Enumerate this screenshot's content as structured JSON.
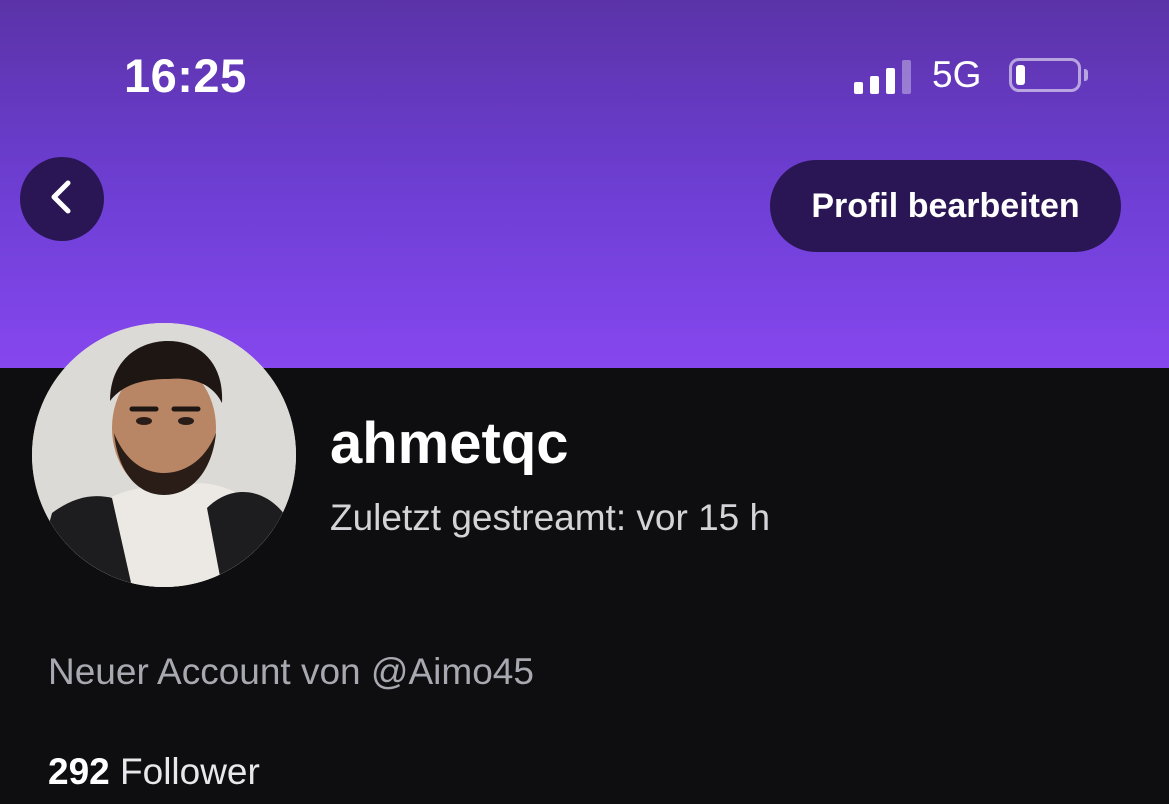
{
  "status_bar": {
    "time": "16:25",
    "network": "5G",
    "signal_bars_active": 3,
    "signal_bars_total": 4,
    "battery_level_fraction": 0.15
  },
  "header": {
    "back_icon": "chevron-left-icon",
    "edit_profile_label": "Profil bearbeiten",
    "gradient_colors": [
      "#5b33a8",
      "#8647ee"
    ]
  },
  "profile": {
    "username": "ahmetqc",
    "last_stream": "Zuletzt gestreamt: vor 15 h",
    "bio": "Neuer Account von @Aimo45",
    "followers_count": "292",
    "followers_label": "Follower"
  }
}
